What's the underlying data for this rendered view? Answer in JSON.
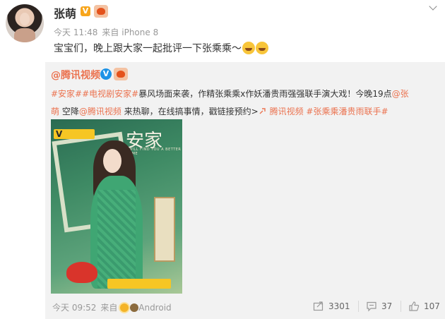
{
  "post": {
    "username": "张萌",
    "verified_badge": "V",
    "time": "今天 11:48",
    "from_label": "来自",
    "device": "iPhone 8",
    "text": "宝宝们，晚上跟大家一起批评一下张乘乘～"
  },
  "repost": {
    "username": "@腾讯视频",
    "badge": "V",
    "line1": {
      "tag1": "#安家#",
      "tag2": "#电视剧安家#",
      "text": "暴风场面来袭，作精张乘乘x作妖潘贵雨强强联手演大戏！今晚19点",
      "mention": "@张"
    },
    "line2": {
      "mention_cont": "萌",
      "text1": " 空降",
      "mention2": "@腾讯视频",
      "text2": " 来热聊，在线搞事情，戳链接预约>",
      "link": "腾讯视频",
      "tag": "#张乘乘潘贵雨联手#"
    },
    "poster": {
      "title": "安家",
      "subtitle": "I WILL FIND YOU A BETTER HOME"
    },
    "footer": {
      "time": "今天 09:52",
      "from_label": "来自",
      "device": "Android"
    },
    "actions": {
      "repost_count": "3301",
      "comment_count": "37",
      "like_count": "107"
    }
  },
  "icons": {
    "menu": "chevron-down-icon",
    "repost": "repost-icon",
    "comment": "comment-icon",
    "like": "like-icon"
  },
  "colors": {
    "accent": "#eb7350",
    "verified_blue": "#1e93e6",
    "verified_orange": "#f7a51c"
  }
}
